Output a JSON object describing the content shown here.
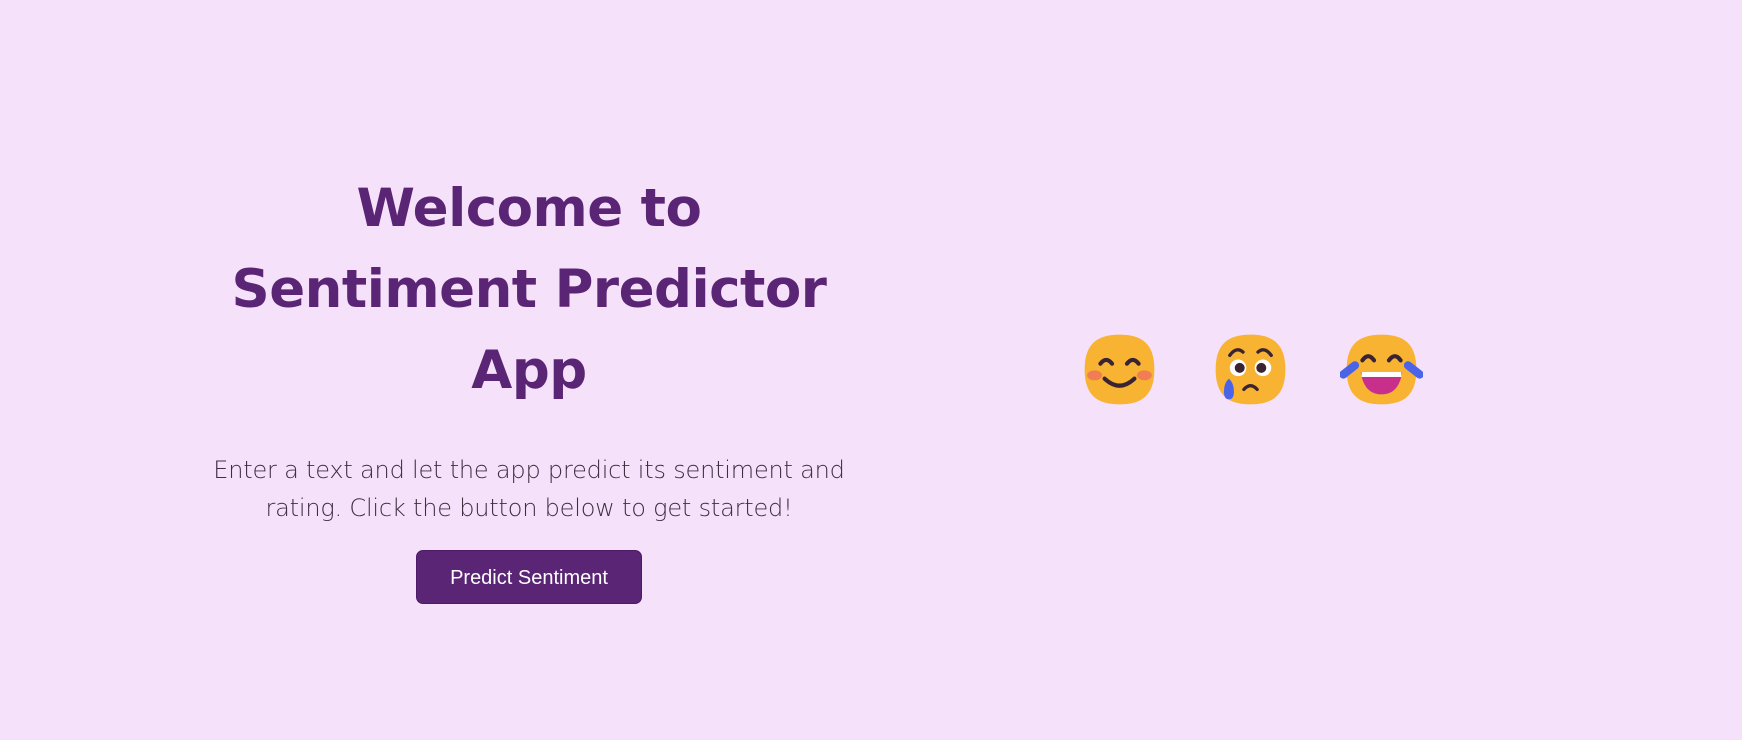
{
  "hero": {
    "title_line_1": "Welcome to",
    "title_line_2": "Sentiment Predictor",
    "title_line_3": "App",
    "description": "Enter a text and let the app predict its sentiment and rating. Click the button below to get started!",
    "cta_label": "Predict Sentiment"
  },
  "emojis": [
    {
      "name": "smiling-face-with-blush-icon"
    },
    {
      "name": "crying-worried-face-icon"
    },
    {
      "name": "laughing-with-tears-face-icon"
    }
  ],
  "colors": {
    "background": "#f6e1fb",
    "accent": "#5b2575",
    "text": "#3d2f40",
    "emoji_yellow": "#f8b333",
    "tear_blue": "#4b63e6",
    "mouth_magenta": "#c82f8a"
  }
}
